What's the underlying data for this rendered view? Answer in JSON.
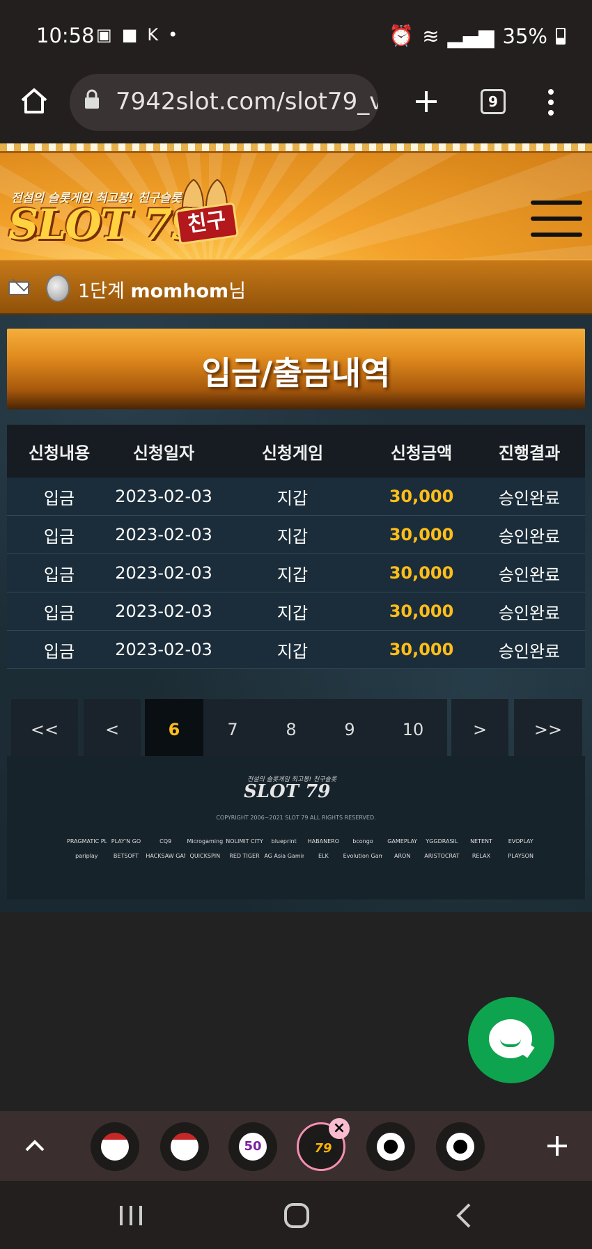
{
  "status": {
    "time": "10:58",
    "battery": "35%"
  },
  "browser": {
    "url": "7942slot.com/slot79_v",
    "tab_count": "9"
  },
  "site": {
    "tagline": "전설의 슬롯게임 최고봉! 친구슬롯",
    "logo": "SLOT 79",
    "logo_badge": "친구",
    "user": {
      "level": "1단계",
      "name": "momhom",
      "suffix": "님"
    },
    "page_title": "입금/출금내역"
  },
  "table": {
    "headers": [
      "신청내용",
      "신청일자",
      "신청게임",
      "신청금액",
      "진행결과"
    ],
    "rows": [
      [
        "입금",
        "2023-02-03",
        "지갑",
        "30,000",
        "승인완료"
      ],
      [
        "입금",
        "2023-02-03",
        "지갑",
        "30,000",
        "승인완료"
      ],
      [
        "입금",
        "2023-02-03",
        "지갑",
        "30,000",
        "승인완료"
      ],
      [
        "입금",
        "2023-02-03",
        "지갑",
        "30,000",
        "승인완료"
      ],
      [
        "입금",
        "2023-02-03",
        "지갑",
        "30,000",
        "승인완료"
      ]
    ]
  },
  "pagination": {
    "first": "<<",
    "prev": "<",
    "pages": [
      "6",
      "7",
      "8",
      "9",
      "10"
    ],
    "current": "6",
    "next": ">",
    "last": ">>"
  },
  "footer": {
    "tagline": "전설의 슬롯게임 최고봉! 친구슬롯",
    "logo": "SLOT 79",
    "copyright": "COPYRIGHT 2006~2021 SLOT 79 ALL RIGHTS RESERVED.",
    "brands": [
      "PRAGMATIC PLAY",
      "PLAY'N GO",
      "CQ9",
      "Microgaming",
      "NOLIMIT CITY",
      "blueprint",
      "HABANERO",
      "bcongo",
      "GAMEPLAY",
      "YGGDRASIL",
      "NETENT",
      "EVOPLAY",
      "pariplay",
      "BETSOFT",
      "HACKSAW GAMING",
      "QUICKSPIN",
      "RED TIGER",
      "AG Asia Gaming",
      "ELK",
      "Evolution Gaming",
      "ARON",
      "ARISTOCRAT",
      "RELAX",
      "PLAYSON"
    ]
  },
  "tabs": {
    "badge_text": "50",
    "logo_tab": "79"
  }
}
